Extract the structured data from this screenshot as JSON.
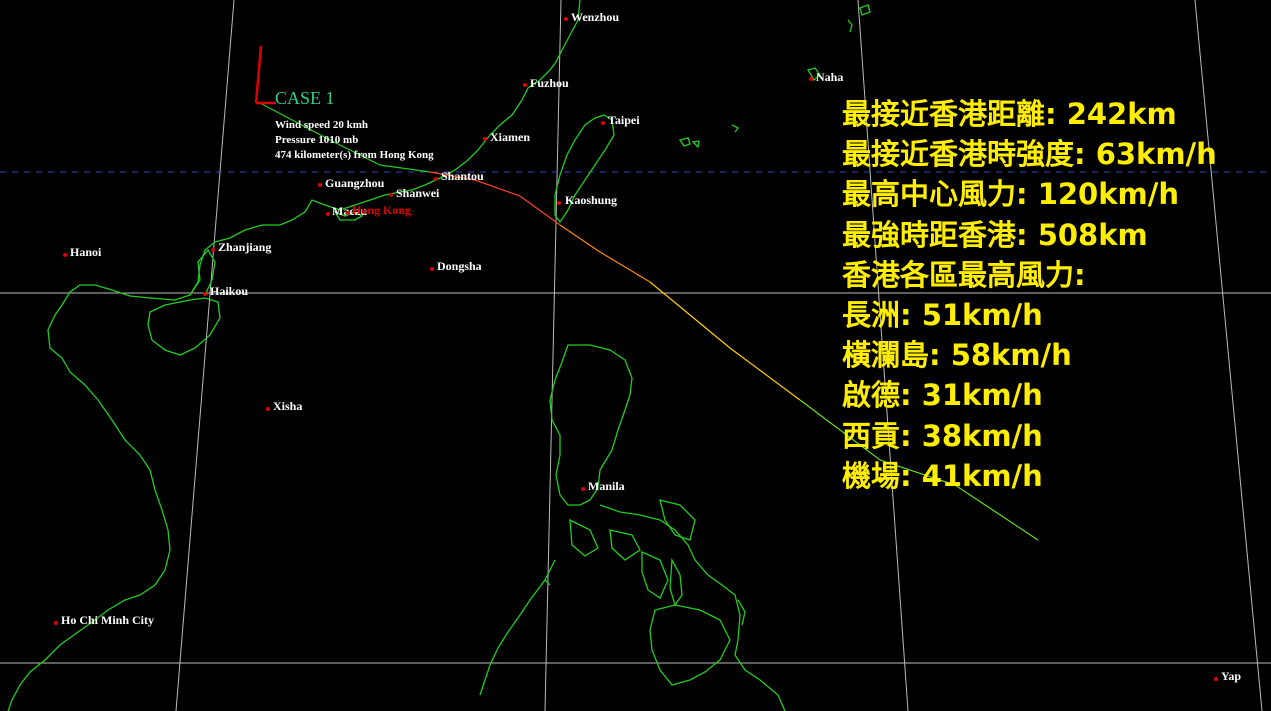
{
  "case": {
    "title": "CASE 1",
    "wind_speed": "Wind speed 20 kmh",
    "pressure": "Pressure 1010 mb",
    "distance": "474 kilometer(s) from Hong Kong"
  },
  "cities": [
    {
      "id": "wenzhou",
      "name": "Wenzhou"
    },
    {
      "id": "fuzhou",
      "name": "Fuzhou"
    },
    {
      "id": "naha",
      "name": "Naha"
    },
    {
      "id": "taipei",
      "name": "Taipei"
    },
    {
      "id": "xiamen",
      "name": "Xiamen"
    },
    {
      "id": "shantou",
      "name": "Shantou"
    },
    {
      "id": "guangzhou",
      "name": "Guangzhou"
    },
    {
      "id": "shanwei",
      "name": "Shanwei"
    },
    {
      "id": "kaoshung",
      "name": "Kaoshung"
    },
    {
      "id": "macau",
      "name": "Macau"
    },
    {
      "id": "hongkong",
      "name": "Hong Kong"
    },
    {
      "id": "zhanjiang",
      "name": "Zhanjiang"
    },
    {
      "id": "hanoi",
      "name": "Hanoi"
    },
    {
      "id": "dongsha",
      "name": "Dongsha"
    },
    {
      "id": "haikou",
      "name": "Haikou"
    },
    {
      "id": "xisha",
      "name": "Xisha"
    },
    {
      "id": "manila",
      "name": "Manila"
    },
    {
      "id": "hcmc",
      "name": "Ho Chi Minh City"
    },
    {
      "id": "yap",
      "name": "Yap"
    }
  ],
  "stats": [
    "最接近香港距離: 242km",
    "最接近香港時強度: 63km/h",
    "最高中心風力: 120km/h",
    "最強時距香港: 508km",
    "香港各區最高風力:",
    "長洲: 51km/h",
    "橫瀾島: 58km/h",
    "啟德: 31km/h",
    "西貢: 38km/h",
    "機場: 41km/h"
  ],
  "colors": {
    "coastline": "#22cc22",
    "grid": "#bbbbbb",
    "city_marker": "#e00000",
    "stats_text": "#ffee00",
    "case_title": "#2fd08a"
  }
}
